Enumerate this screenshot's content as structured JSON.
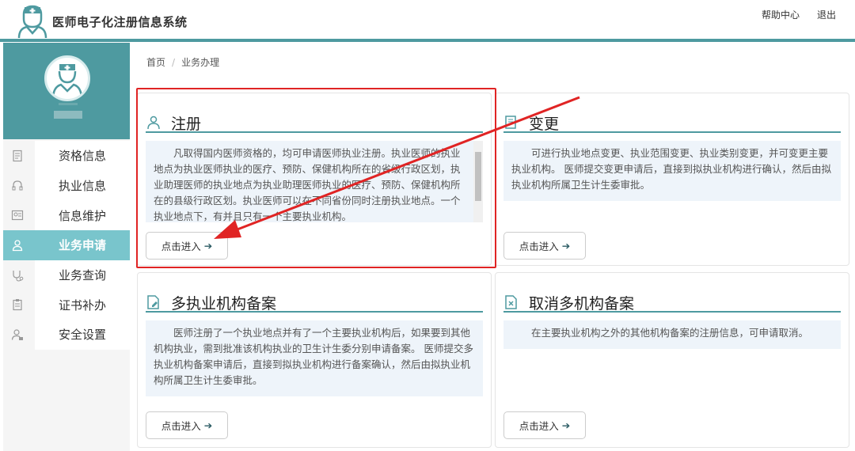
{
  "header": {
    "app_title": "医师电子化注册信息系统",
    "help_link": "帮助中心",
    "logout_link": "退出",
    "accent_color": "#4e9aa0"
  },
  "breadcrumb": {
    "home": "首页",
    "separator": "/",
    "current": "业务办理"
  },
  "sidebar": {
    "items": [
      {
        "label": "资格信息",
        "icon": "document-icon"
      },
      {
        "label": "执业信息",
        "icon": "headset-icon"
      },
      {
        "label": "信息维护",
        "icon": "id-card-icon"
      },
      {
        "label": "业务申请",
        "icon": "user-icon",
        "active": true
      },
      {
        "label": "业务查询",
        "icon": "stethoscope-icon"
      },
      {
        "label": "证书补办",
        "icon": "clipboard-icon"
      },
      {
        "label": "安全设置",
        "icon": "user-lock-icon"
      }
    ]
  },
  "cards": [
    {
      "title": "注册",
      "icon": "user-icon",
      "description": "凡取得国内医师资格的，均可申请医师执业注册。执业医师的执业地点为执业医师执业的医疗、预防、保健机构所在的省级行政区划，执业助理医师的执业地点为执业助理医师执业的医疗、预防、保健机构所在的县级行政区划。执业医师可以在不同省份同时注册执业地点。一个执业地点下，有并且只有一个主要执业机构。",
      "button": "点击进入"
    },
    {
      "title": "变更",
      "icon": "document-edit-icon",
      "description": "可进行执业地点变更、执业范围变更、执业类别变更，并可变更主要执业机构。 医师提交变更申请后，直接到拟执业机构进行确认，然后由拟执业机构所属卫生计生委审批。",
      "button": "点击进入"
    },
    {
      "title": "多执业机构备案",
      "icon": "file-edit-icon",
      "description": "医师注册了一个执业地点并有了一个主要执业机构后，如果要到其他机构执业，需到批准该机构执业的卫生计生委分别申请备案。 医师提交多执业机构备案申请后，直接到拟执业机构进行备案确认，然后由拟执业机构所属卫生计生委审批。",
      "button": "点击进入"
    },
    {
      "title": "取消多机构备案",
      "icon": "file-cancel-icon",
      "description": "在主要执业机构之外的其他机构备案的注册信息，可申请取消。",
      "button": "点击进入"
    }
  ],
  "annotation_color": "#e02424"
}
